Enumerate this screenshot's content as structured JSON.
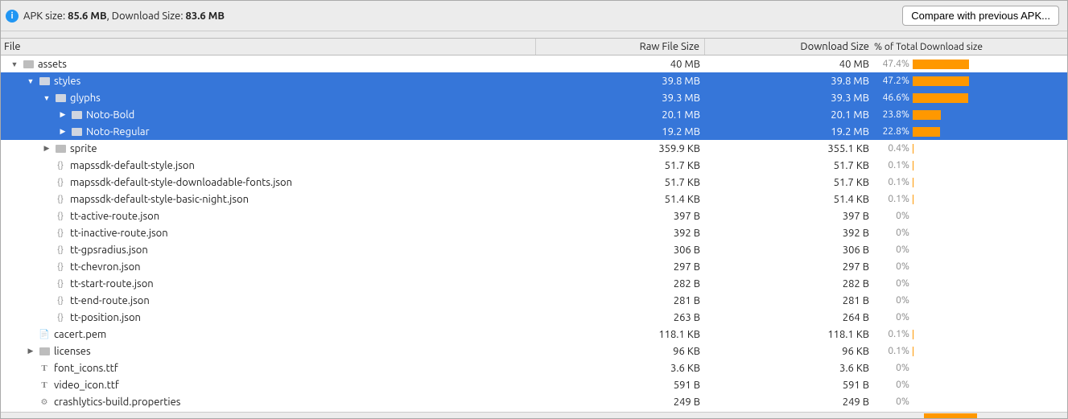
{
  "top": {
    "apk_size_label": "APK size: ",
    "apk_size_value": "85.6 MB",
    "download_size_label": ", Download Size: ",
    "download_size_value": "83.6 MB",
    "compare_button": "Compare with previous APK..."
  },
  "headers": {
    "file": "File",
    "raw": "Raw File Size",
    "dl": "Download Size",
    "pct": "% of Total Download size"
  },
  "rows": [
    {
      "indent": 0,
      "arrow": "down",
      "icon": "folder",
      "name": "assets",
      "raw": "40 MB",
      "dl": "40 MB",
      "pct": "47.4%",
      "bar": 47.4,
      "sel": false
    },
    {
      "indent": 1,
      "arrow": "down",
      "icon": "folder",
      "name": "styles",
      "raw": "39.8 MB",
      "dl": "39.8 MB",
      "pct": "47.2%",
      "bar": 47.2,
      "sel": true
    },
    {
      "indent": 2,
      "arrow": "down",
      "icon": "folder",
      "name": "glyphs",
      "raw": "39.3 MB",
      "dl": "39.3 MB",
      "pct": "46.6%",
      "bar": 46.6,
      "sel": true
    },
    {
      "indent": 3,
      "arrow": "right",
      "icon": "folder",
      "name": "Noto-Bold",
      "raw": "20.1 MB",
      "dl": "20.1 MB",
      "pct": "23.8%",
      "bar": 23.8,
      "sel": true
    },
    {
      "indent": 3,
      "arrow": "right",
      "icon": "folder",
      "name": "Noto-Regular",
      "raw": "19.2 MB",
      "dl": "19.2 MB",
      "pct": "22.8%",
      "bar": 22.8,
      "sel": true
    },
    {
      "indent": 2,
      "arrow": "right",
      "icon": "folder",
      "name": "sprite",
      "raw": "359.9 KB",
      "dl": "355.1 KB",
      "pct": "0.4%",
      "bar": 0.4,
      "sel": false
    },
    {
      "indent": 2,
      "arrow": "none",
      "icon": "json",
      "name": "mapssdk-default-style.json",
      "raw": "51.7 KB",
      "dl": "51.7 KB",
      "pct": "0.1%",
      "bar": 0.1,
      "sel": false
    },
    {
      "indent": 2,
      "arrow": "none",
      "icon": "json",
      "name": "mapssdk-default-style-downloadable-fonts.json",
      "raw": "51.7 KB",
      "dl": "51.7 KB",
      "pct": "0.1%",
      "bar": 0.1,
      "sel": false
    },
    {
      "indent": 2,
      "arrow": "none",
      "icon": "json",
      "name": "mapssdk-default-style-basic-night.json",
      "raw": "51.4 KB",
      "dl": "51.4 KB",
      "pct": "0.1%",
      "bar": 0.1,
      "sel": false
    },
    {
      "indent": 2,
      "arrow": "none",
      "icon": "json",
      "name": "tt-active-route.json",
      "raw": "397 B",
      "dl": "397 B",
      "pct": "0%",
      "bar": 0,
      "sel": false
    },
    {
      "indent": 2,
      "arrow": "none",
      "icon": "json",
      "name": "tt-inactive-route.json",
      "raw": "392 B",
      "dl": "392 B",
      "pct": "0%",
      "bar": 0,
      "sel": false
    },
    {
      "indent": 2,
      "arrow": "none",
      "icon": "json",
      "name": "tt-gpsradius.json",
      "raw": "306 B",
      "dl": "306 B",
      "pct": "0%",
      "bar": 0,
      "sel": false
    },
    {
      "indent": 2,
      "arrow": "none",
      "icon": "json",
      "name": "tt-chevron.json",
      "raw": "297 B",
      "dl": "297 B",
      "pct": "0%",
      "bar": 0,
      "sel": false
    },
    {
      "indent": 2,
      "arrow": "none",
      "icon": "json",
      "name": "tt-start-route.json",
      "raw": "282 B",
      "dl": "282 B",
      "pct": "0%",
      "bar": 0,
      "sel": false
    },
    {
      "indent": 2,
      "arrow": "none",
      "icon": "json",
      "name": "tt-end-route.json",
      "raw": "281 B",
      "dl": "281 B",
      "pct": "0%",
      "bar": 0,
      "sel": false
    },
    {
      "indent": 2,
      "arrow": "none",
      "icon": "json",
      "name": "tt-position.json",
      "raw": "263 B",
      "dl": "264 B",
      "pct": "0%",
      "bar": 0,
      "sel": false
    },
    {
      "indent": 1,
      "arrow": "none",
      "icon": "cert",
      "name": "cacert.pem",
      "raw": "118.1 KB",
      "dl": "118.1 KB",
      "pct": "0.1%",
      "bar": 0.1,
      "sel": false
    },
    {
      "indent": 1,
      "arrow": "right",
      "icon": "folder",
      "name": "licenses",
      "raw": "96 KB",
      "dl": "96 KB",
      "pct": "0.1%",
      "bar": 0.1,
      "sel": false
    },
    {
      "indent": 1,
      "arrow": "none",
      "icon": "ttf",
      "name": "font_icons.ttf",
      "raw": "3.6 KB",
      "dl": "3.6 KB",
      "pct": "0%",
      "bar": 0,
      "sel": false
    },
    {
      "indent": 1,
      "arrow": "none",
      "icon": "ttf",
      "name": "video_icon.ttf",
      "raw": "591 B",
      "dl": "591 B",
      "pct": "0%",
      "bar": 0,
      "sel": false
    },
    {
      "indent": 1,
      "arrow": "none",
      "icon": "prop",
      "name": "crashlytics-build.properties",
      "raw": "249 B",
      "dl": "249 B",
      "pct": "0%",
      "bar": 0,
      "sel": false
    }
  ]
}
